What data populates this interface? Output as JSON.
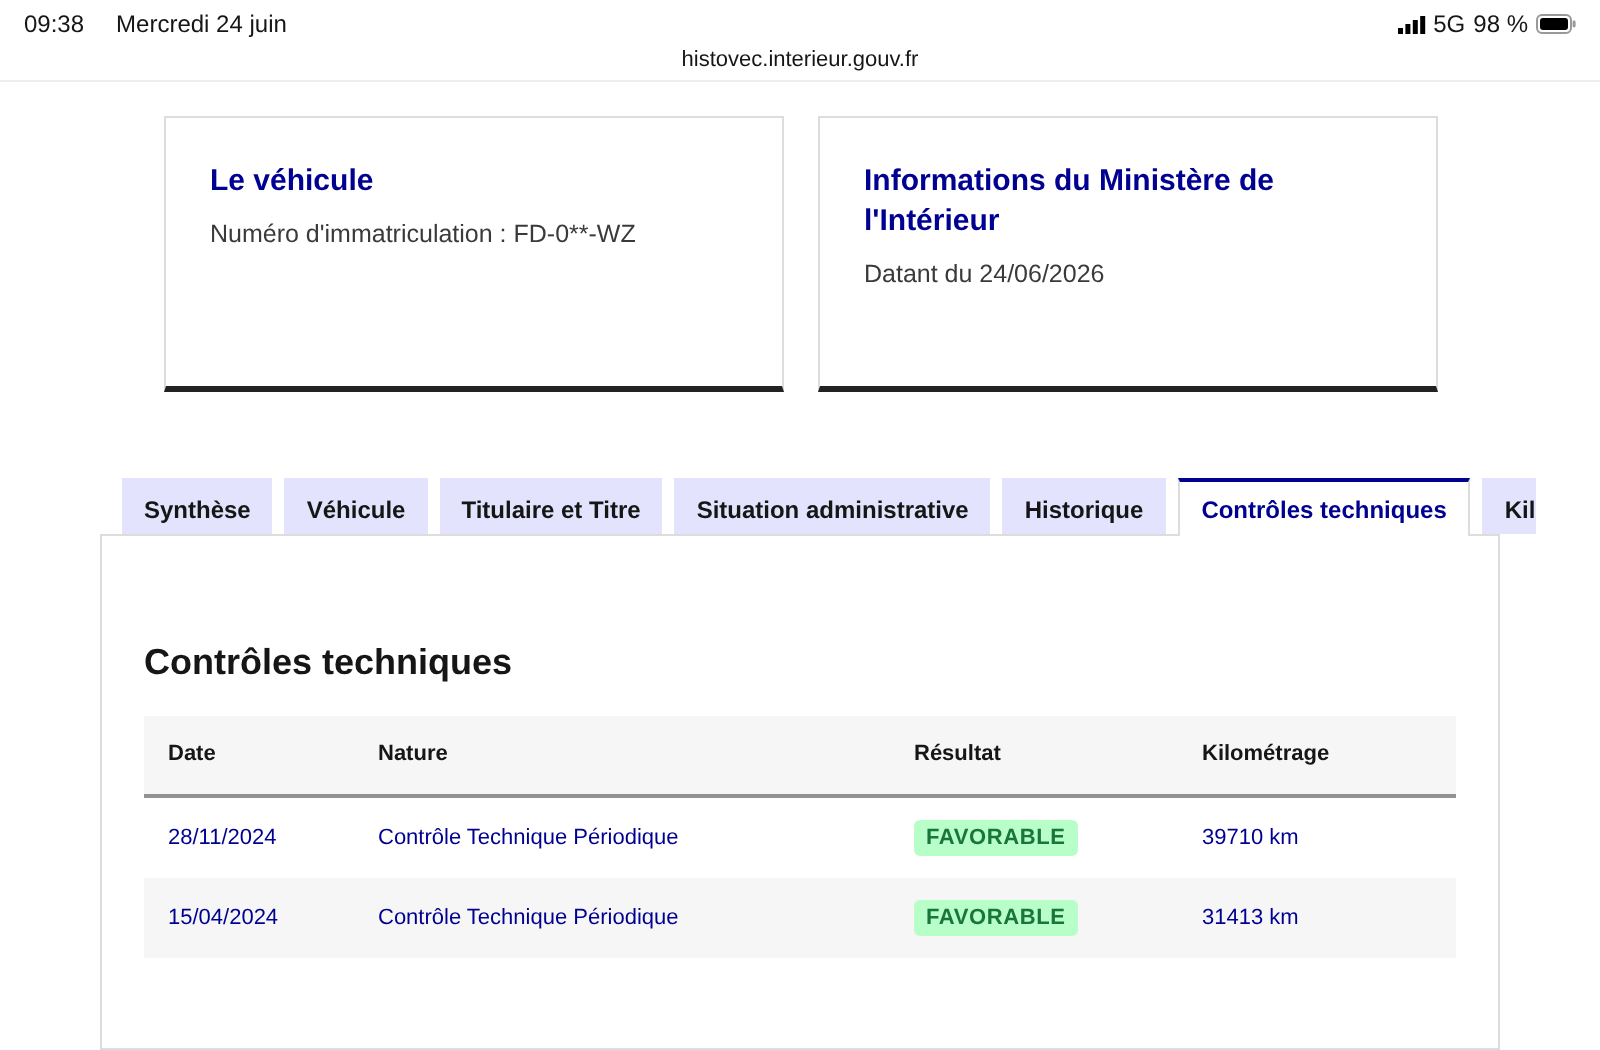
{
  "status_bar": {
    "time": "09:38",
    "date": "Mercredi 24 juin",
    "network": "5G",
    "battery": "98 %"
  },
  "address_bar": {
    "url": "histovec.interieur.gouv.fr"
  },
  "cards": [
    {
      "title": "Le véhicule",
      "text": "Numéro d'immatriculation : FD-0**-WZ"
    },
    {
      "title": "Informations du Ministère de l'Intérieur",
      "text": "Datant du 24/06/2026"
    }
  ],
  "tabs": [
    {
      "label": "Synthèse",
      "selected": false
    },
    {
      "label": "Véhicule",
      "selected": false
    },
    {
      "label": "Titulaire et Titre",
      "selected": false
    },
    {
      "label": "Situation administrative",
      "selected": false
    },
    {
      "label": "Historique",
      "selected": false
    },
    {
      "label": "Contrôles techniques",
      "selected": true
    },
    {
      "label": "Kil",
      "selected": false
    }
  ],
  "panel": {
    "heading": "Contrôles techniques",
    "table": {
      "columns": [
        "Date",
        "Nature",
        "Résultat",
        "Kilométrage"
      ],
      "rows": [
        {
          "date": "28/11/2024",
          "nature": "Contrôle Technique Périodique",
          "result": {
            "label": "FAVORABLE",
            "kind": "success"
          },
          "mileage": "39710 km"
        },
        {
          "date": "15/04/2024",
          "nature": "Contrôle Technique Périodique",
          "result": {
            "label": "FAVORABLE",
            "kind": "success"
          },
          "mileage": "31413 km"
        }
      ]
    }
  }
}
